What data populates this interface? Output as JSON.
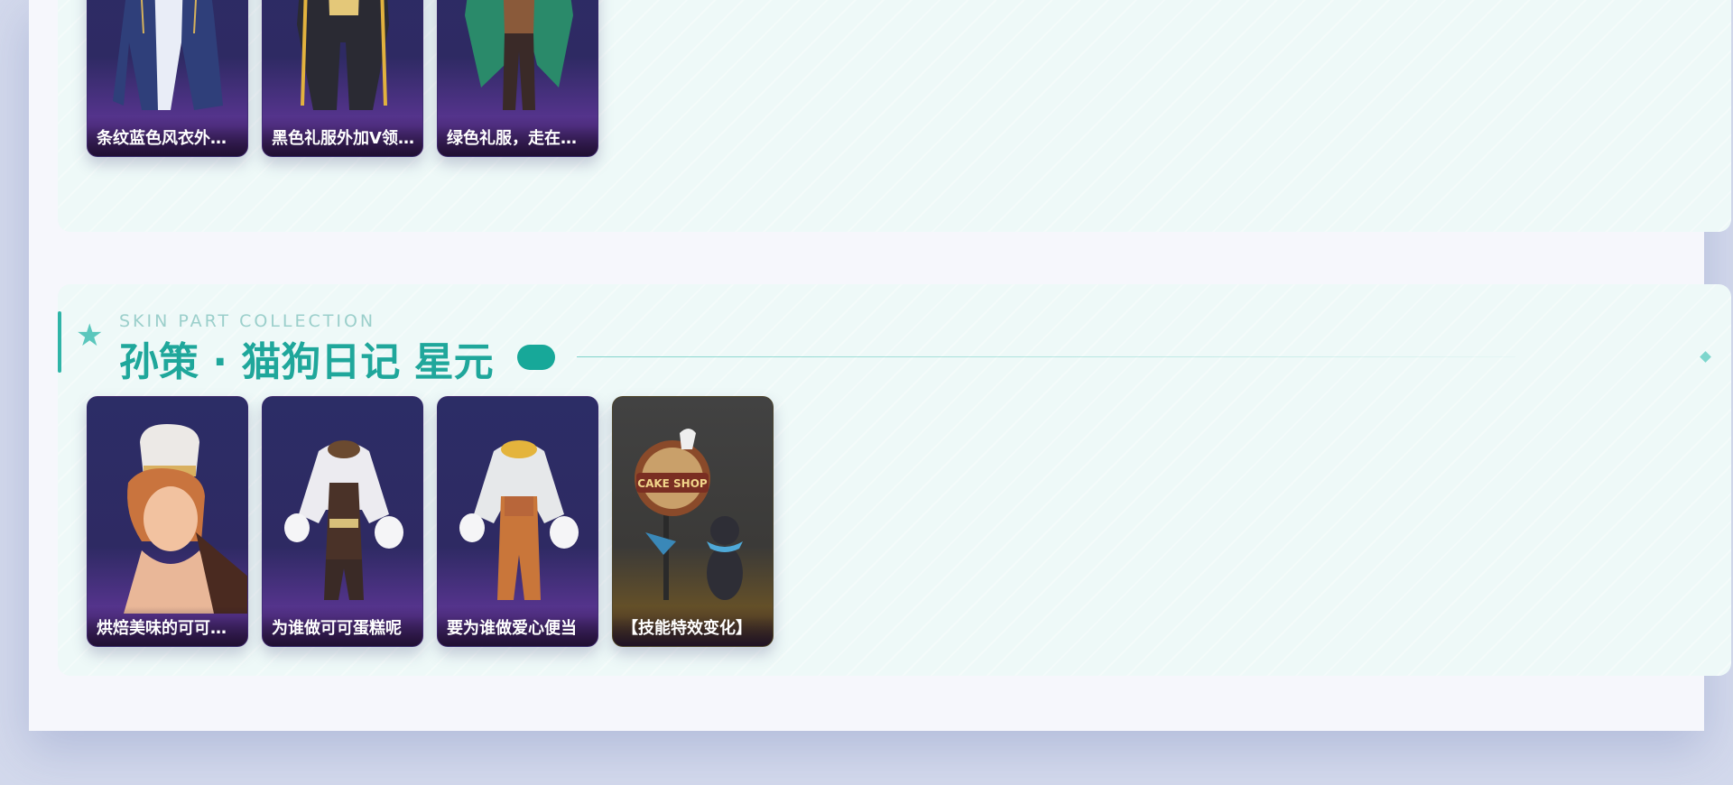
{
  "top_section": {
    "cards": [
      {
        "label": "条纹蓝色风衣外套，搭配马甲衬衫",
        "art": "outfit-blue-striped-coat"
      },
      {
        "label": "黑色礼服外加V领马甲",
        "art": "outfit-black-suit-gold"
      },
      {
        "label": "绿色礼服，走在时尚前沿",
        "art": "outfit-green-suit"
      }
    ]
  },
  "bottom_section": {
    "eyebrow": "SKIN PART COLLECTION",
    "title": "孙策 · 猫狗日记 星元",
    "cards": [
      {
        "label": "烘焙美味的可可蛋糕",
        "art": "head-chef-hat",
        "theme": "purple"
      },
      {
        "label": "为谁做可可蛋糕呢",
        "art": "outfit-chocolate-apron",
        "theme": "purple"
      },
      {
        "label": "要为谁做爱心便当",
        "art": "outfit-orange-overalls",
        "theme": "purple"
      },
      {
        "label": "【技能特效变化】",
        "art": "cake-shop-dog-sign",
        "theme": "brown"
      }
    ]
  },
  "colors": {
    "accent": "#1fa79b",
    "card_purple": "#2c2d66",
    "card_brown": "#424242",
    "page_bg": "#d3d9ec"
  },
  "icons": {
    "header_star": "star-icon"
  }
}
